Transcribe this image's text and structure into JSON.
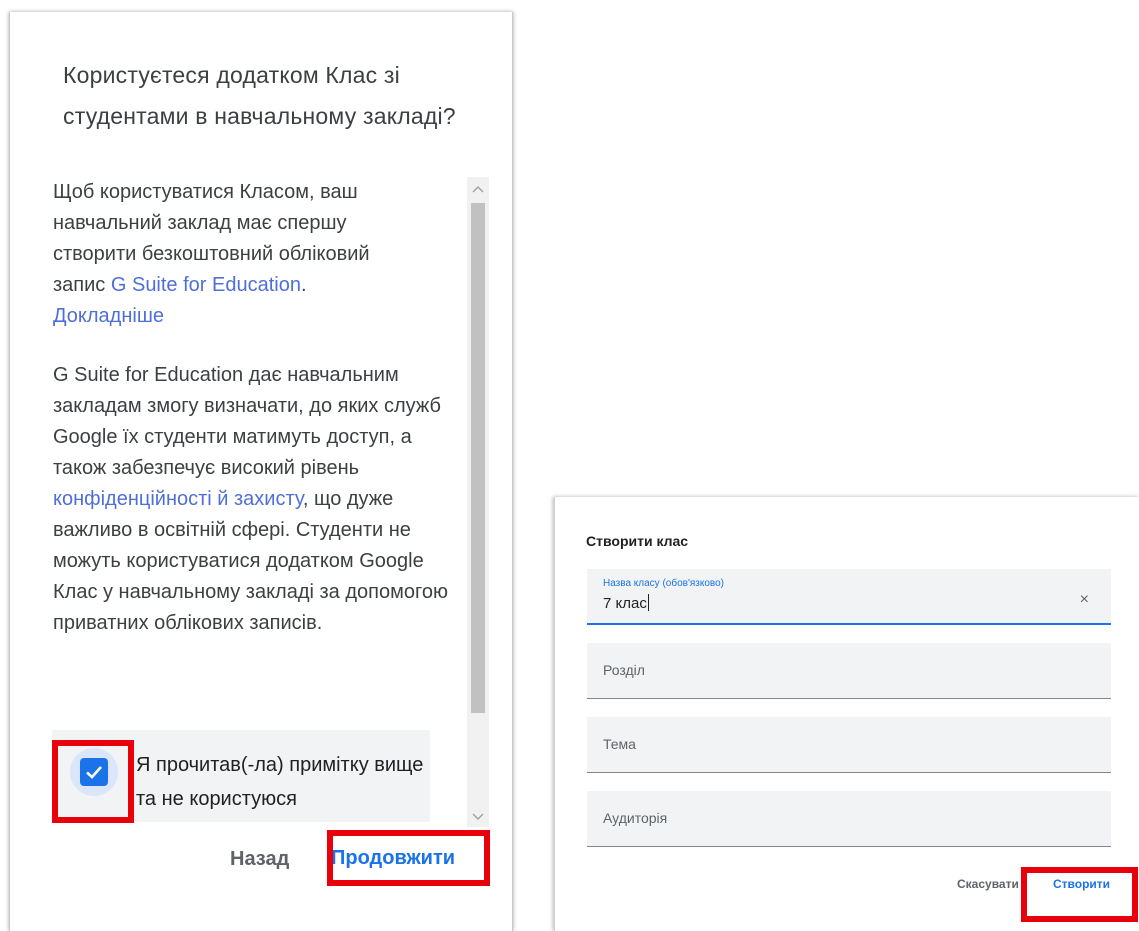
{
  "left_dialog": {
    "title": "Користуєтеся додатком Клас зі студентами в навчальному закладі?",
    "para1": {
      "text_before": "Щоб користуватися Класом, ваш навчальний заклад має спершу створити безкоштовний обліковий запис ",
      "link1": "G Suite for Education",
      "text_mid": ". ",
      "link2": "Докладніше"
    },
    "para2": {
      "text_before": "G Suite for Education дає навчальним закладам змогу визначати, до яких служб Google їх студенти матимуть доступ, а також забезпечує високий рівень ",
      "link": "конфіденційності й захисту",
      "text_after": ", що дуже важливо в освітній сфері. Студенти не можуть користуватися додатком Google Клас у навчальному закладі за допомогою приватних облікових записів."
    },
    "consent_text": "Я прочитав(-ла) примітку вище та не користуюся",
    "checkbox_checked": true,
    "back_label": "Назад",
    "continue_label": "Продовжити"
  },
  "right_dialog": {
    "title": "Створити клас",
    "fields": [
      {
        "label": "Назва класу (обов'язково)",
        "value": "7 клас",
        "clear_icon": "×"
      },
      {
        "placeholder": "Розділ"
      },
      {
        "placeholder": "Тема"
      },
      {
        "placeholder": "Аудиторія"
      }
    ],
    "cancel_label": "Скасувати",
    "create_label": "Створити"
  },
  "colors": {
    "accent": "#1a73e8",
    "link": "#4f6fd8",
    "highlight": "#e8000b"
  }
}
